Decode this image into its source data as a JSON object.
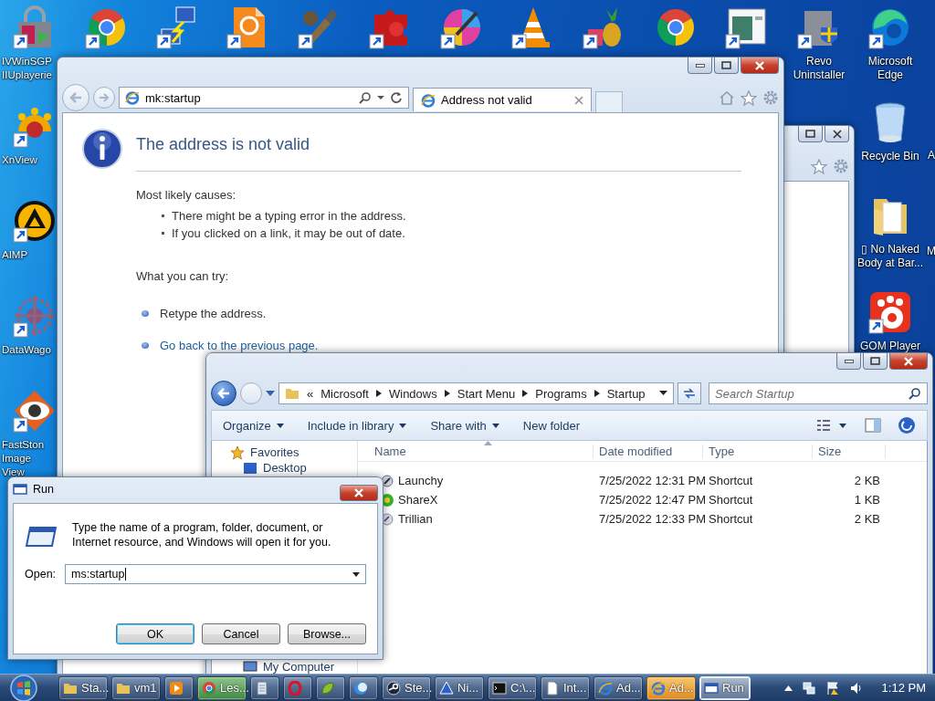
{
  "desktop": {
    "top_icons": [
      {
        "kind": "lock",
        "label": "IVWinSGP IIUplayerie",
        "shortcut": true
      },
      {
        "kind": "chrome",
        "shortcut": true
      },
      {
        "kind": "network",
        "shortcut": true
      },
      {
        "kind": "pdf",
        "shortcut": true
      },
      {
        "kind": "brush",
        "shortcut": true
      },
      {
        "kind": "puzzle",
        "shortcut": true
      },
      {
        "kind": "paint",
        "shortcut": true
      },
      {
        "kind": "cone",
        "shortcut": true
      },
      {
        "kind": "fruit",
        "shortcut": true
      },
      {
        "kind": "chrome"
      },
      {
        "kind": "window",
        "shortcut": true
      },
      {
        "kind": "box",
        "label": "Revo Uninstaller",
        "shortcut": true
      },
      {
        "kind": "edge",
        "label": "Microsoft Edge",
        "shortcut": true
      }
    ],
    "left_icons": [
      {
        "kind": "sun",
        "label": "XnView",
        "shortcut": true
      },
      {
        "kind": "aimp",
        "label": "AIMP",
        "shortcut": true
      },
      {
        "kind": "pattern",
        "label": "DataWago",
        "shortcut": true
      },
      {
        "kind": "eye",
        "label": "FastSton Image View",
        "shortcut": true
      }
    ],
    "right_icons": [
      {
        "kind": "bin",
        "label": "Recycle Bin"
      },
      {
        "kind": "cut",
        "label": "A"
      },
      {
        "kind": "folder",
        "label": "▯ No Naked Body at Bar..."
      },
      {
        "kind": "cut",
        "label": "M"
      },
      {
        "kind": "gom",
        "label": "GOM Player",
        "shortcut": true
      }
    ]
  },
  "browser": {
    "address": "mk:startup",
    "tab": {
      "title": "Address not valid"
    },
    "heading": "The address is not valid",
    "causes_title": "Most likely causes:",
    "causes": [
      "There might be a typing error in the address.",
      "If you clicked on a link, it may be out of date."
    ],
    "try_title": "What you can try:",
    "actions": [
      {
        "text": "Retype the address.",
        "kind": "text"
      },
      {
        "text": "Go back to the previous page.",
        "kind": "link"
      }
    ]
  },
  "explorer": {
    "overflow": "«",
    "breadcrumb": [
      "Microsoft",
      "Windows",
      "Start Menu",
      "Programs",
      "Startup"
    ],
    "search": {
      "placeholder": "Search Startup"
    },
    "toolbar": [
      {
        "label": "Organize",
        "menu": true
      },
      {
        "label": "Include in library",
        "menu": true
      },
      {
        "label": "Share with",
        "menu": true
      },
      {
        "label": "New folder",
        "menu": false
      }
    ],
    "sidebar": [
      {
        "label": "Favorites",
        "kind": "favorites"
      },
      {
        "label": "Desktop",
        "kind": "desktop"
      },
      {
        "label": "My Computer",
        "kind": "computer"
      }
    ],
    "columns": [
      "Name",
      "Date modified",
      "Type",
      "Size"
    ],
    "rows": [
      {
        "name": "Launchy",
        "kind": "launchy",
        "date": "7/25/2022 12:31 PM",
        "type": "Shortcut",
        "size": "2 KB"
      },
      {
        "name": "ShareX",
        "kind": "sharex",
        "date": "7/25/2022 12:47 PM",
        "type": "Shortcut",
        "size": "1 KB"
      },
      {
        "name": "Trillian",
        "kind": "trillian",
        "date": "7/25/2022 12:33 PM",
        "type": "Shortcut",
        "size": "2 KB"
      }
    ]
  },
  "run_dialog": {
    "title": "Run",
    "message": "Type the name of a program, folder, document, or Internet resource, and Windows will open it for you.",
    "open_label": "Open:",
    "value": "ms:startup",
    "buttons": [
      {
        "label": "OK",
        "selected": true
      },
      {
        "label": "Cancel",
        "selected": false
      },
      {
        "label": "Browse...",
        "selected": false
      }
    ]
  },
  "taskbar": {
    "items": [
      {
        "kind": "folder",
        "label": "Sta...",
        "selected": false,
        "flashing": false,
        "hovered": false
      },
      {
        "kind": "folder",
        "label": "vm1",
        "selected": false,
        "flashing": false,
        "hovered": false
      },
      {
        "kind": "media",
        "selected": false,
        "flashing": false,
        "hovered": false
      },
      {
        "kind": "chrome",
        "label": "Les...",
        "selected": false,
        "flashing": false,
        "hovered": true
      },
      {
        "kind": "notepad",
        "selected": false,
        "flashing": false,
        "hovered": false
      },
      {
        "kind": "opera",
        "selected": false,
        "flashing": false,
        "hovered": false
      },
      {
        "kind": "leaf",
        "selected": false,
        "flashing": false,
        "hovered": false
      },
      {
        "kind": "moon",
        "selected": false,
        "flashing": false,
        "hovered": false
      },
      {
        "kind": "steam",
        "label": "Ste...",
        "selected": false,
        "flashing": false,
        "hovered": false
      },
      {
        "kind": "bell",
        "label": "Ni...",
        "selected": false,
        "flashing": false,
        "hovered": false
      },
      {
        "kind": "cmd",
        "label": "C:\\...",
        "selected": false,
        "flashing": false,
        "hovered": false
      },
      {
        "kind": "doc",
        "label": "Int...",
        "selected": false,
        "flashing": false,
        "hovered": false
      },
      {
        "kind": "ie",
        "label": "Ad...",
        "selected": false,
        "flashing": false,
        "hovered": false
      },
      {
        "kind": "ie",
        "label": "Ad...",
        "selected": false,
        "flashing": true,
        "hovered": false
      },
      {
        "kind": "run",
        "label": "Run",
        "selected": true,
        "flashing": false,
        "hovered": false
      }
    ],
    "clock": "1:12 PM"
  }
}
